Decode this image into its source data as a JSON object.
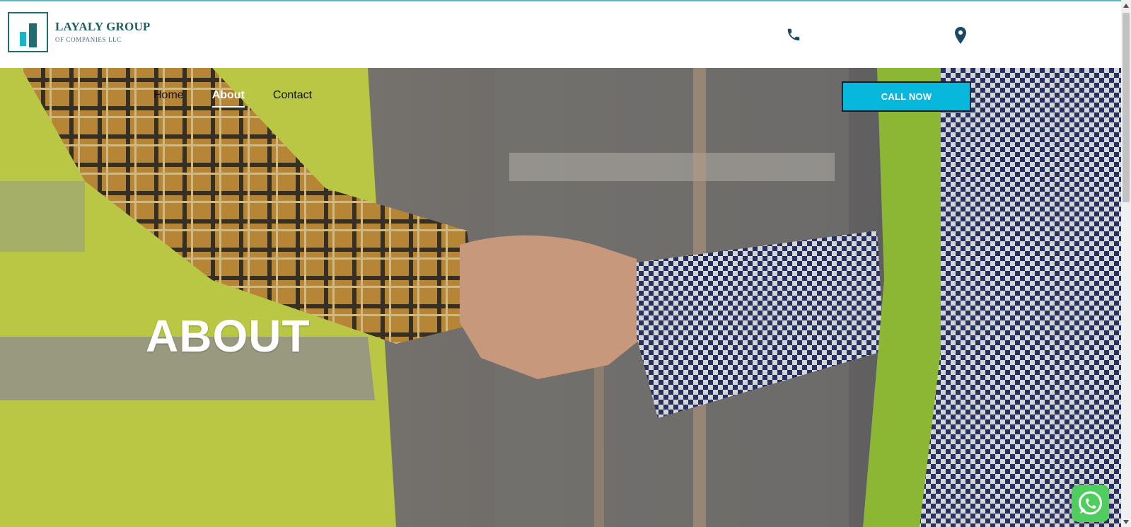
{
  "header": {
    "logo": {
      "title": "LAYALY GROUP",
      "subtitle": "OF COMPANIES LLC"
    },
    "contact": {
      "phone_icon": "phone-icon",
      "phone_text": "",
      "location_icon": "map-pin-icon",
      "location_text": ""
    }
  },
  "nav": {
    "items": [
      {
        "label": "Home",
        "active": false
      },
      {
        "label": "About",
        "active": true
      },
      {
        "label": "Contact",
        "active": false
      }
    ],
    "cta_label": "CALL NOW"
  },
  "hero": {
    "title": "ABOUT"
  },
  "floating": {
    "whatsapp_icon": "whatsapp-icon"
  },
  "colors": {
    "brand_teal": "#1f6f72",
    "accent_cyan": "#08b7dc",
    "whatsapp_green": "#4fcd5f"
  }
}
